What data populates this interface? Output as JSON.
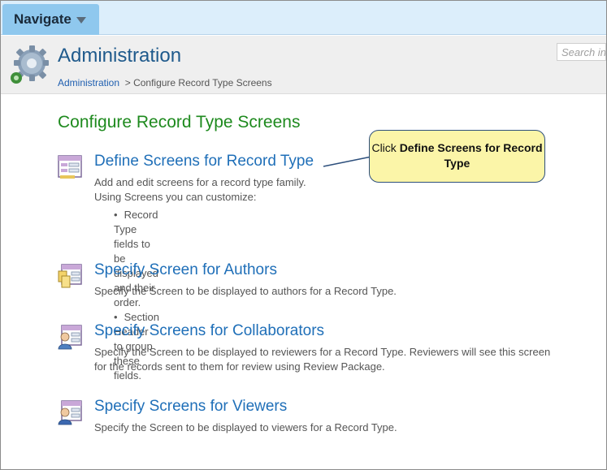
{
  "nav": {
    "label": "Navigate"
  },
  "header": {
    "title": "Administration",
    "breadcrumb": {
      "root": "Administration",
      "separator": ">",
      "current": "Configure Record Type Screens"
    },
    "search_placeholder": "Search in"
  },
  "section_title": "Configure Record Type Screens",
  "items": [
    {
      "link": "Define Screens for Record Type",
      "desc1": "Add and edit screens for a record type family.",
      "desc2": "Using Screens you can customize:",
      "bullets": [
        "Record Type fields to be displayed and their order.",
        "Section Header to group these fields."
      ],
      "icon": "screen-list-icon"
    },
    {
      "link": "Specify Screen for Authors",
      "desc1": "Specify the Screen to be displayed to authors for a Record Type.",
      "icon": "author-screen-icon"
    },
    {
      "link": "Specify Screens for Collaborators",
      "desc1": "Specify the Screen to be displayed to reviewers for a Record Type. Reviewers will see this screen",
      "desc2": "for the records sent to them for review using Review Package.",
      "icon": "collaborator-screen-icon"
    },
    {
      "link": "Specify Screens for Viewers",
      "desc1": "Specify the Screen to be displayed to viewers for a Record Type.",
      "icon": "viewer-screen-icon"
    }
  ],
  "callout": {
    "prefix": "Click",
    "bold": "Define Screens for Record Type"
  },
  "colors": {
    "title_blue": "#1f5a8c",
    "link_blue": "#1f6fb8",
    "section_green": "#1e8a1e",
    "callout_bg": "#fbf5a8",
    "topbar": "#dceefb",
    "nav_button": "#8fc8ee"
  }
}
